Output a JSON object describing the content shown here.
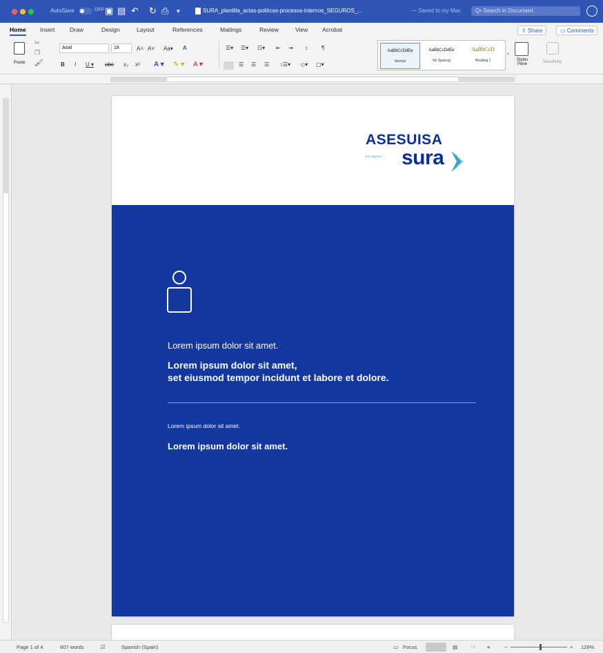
{
  "window": {
    "autosave_label": "AutoSave",
    "autosave_state": "OFF",
    "doc_title": "SURA_plantilla_actas-politicas-procesos-internos_SEGUROS_...",
    "saved_status": "— Saved to my Mac",
    "search_placeholder": "Q• Search in Document"
  },
  "ribbon": {
    "tabs": [
      "Home",
      "Insert",
      "Draw",
      "Design",
      "Layout",
      "References",
      "Mailings",
      "Review",
      "View",
      "Acrobat"
    ],
    "share_label": "Share",
    "comments_label": "Comments",
    "paste_label": "Paste",
    "font_name": "Arial",
    "font_size": "18",
    "styles": [
      {
        "sample": "AaBbCcDdEe",
        "name": "Normal"
      },
      {
        "sample": "AaBbCcDdEe",
        "name": "No Spacing"
      },
      {
        "sample": "AaBbCcD",
        "name": "Heading 1"
      }
    ],
    "styles_pane_label": "Styles Pane",
    "sensitivity_label": "Sensitivity"
  },
  "document": {
    "logo_top": "ASESUISA",
    "logo_bottom": "sura",
    "logo_tagline": "tus seguros",
    "cover_line1": "Lorem ipsum dolor sit amet.",
    "cover_line2": "Lorem ipsum dolor sit amet,",
    "cover_line3": "set eiusmod tempor incidunt et labore et dolore.",
    "cover_line4": "Lorem ipsum dolor sit amet.",
    "cover_line5": "Lorem ipsum dolor sit amet."
  },
  "status": {
    "page": "Page 1 of 4",
    "words": "607 words",
    "language": "Spanish (Spain)",
    "focus": "Focus",
    "zoom": "126%"
  },
  "colors": {
    "titlebar": "#2f56b7",
    "cover_blue": "#1338a0",
    "logo_navy": "#0b2f9a",
    "logo_teal": "#3aa0c8"
  }
}
